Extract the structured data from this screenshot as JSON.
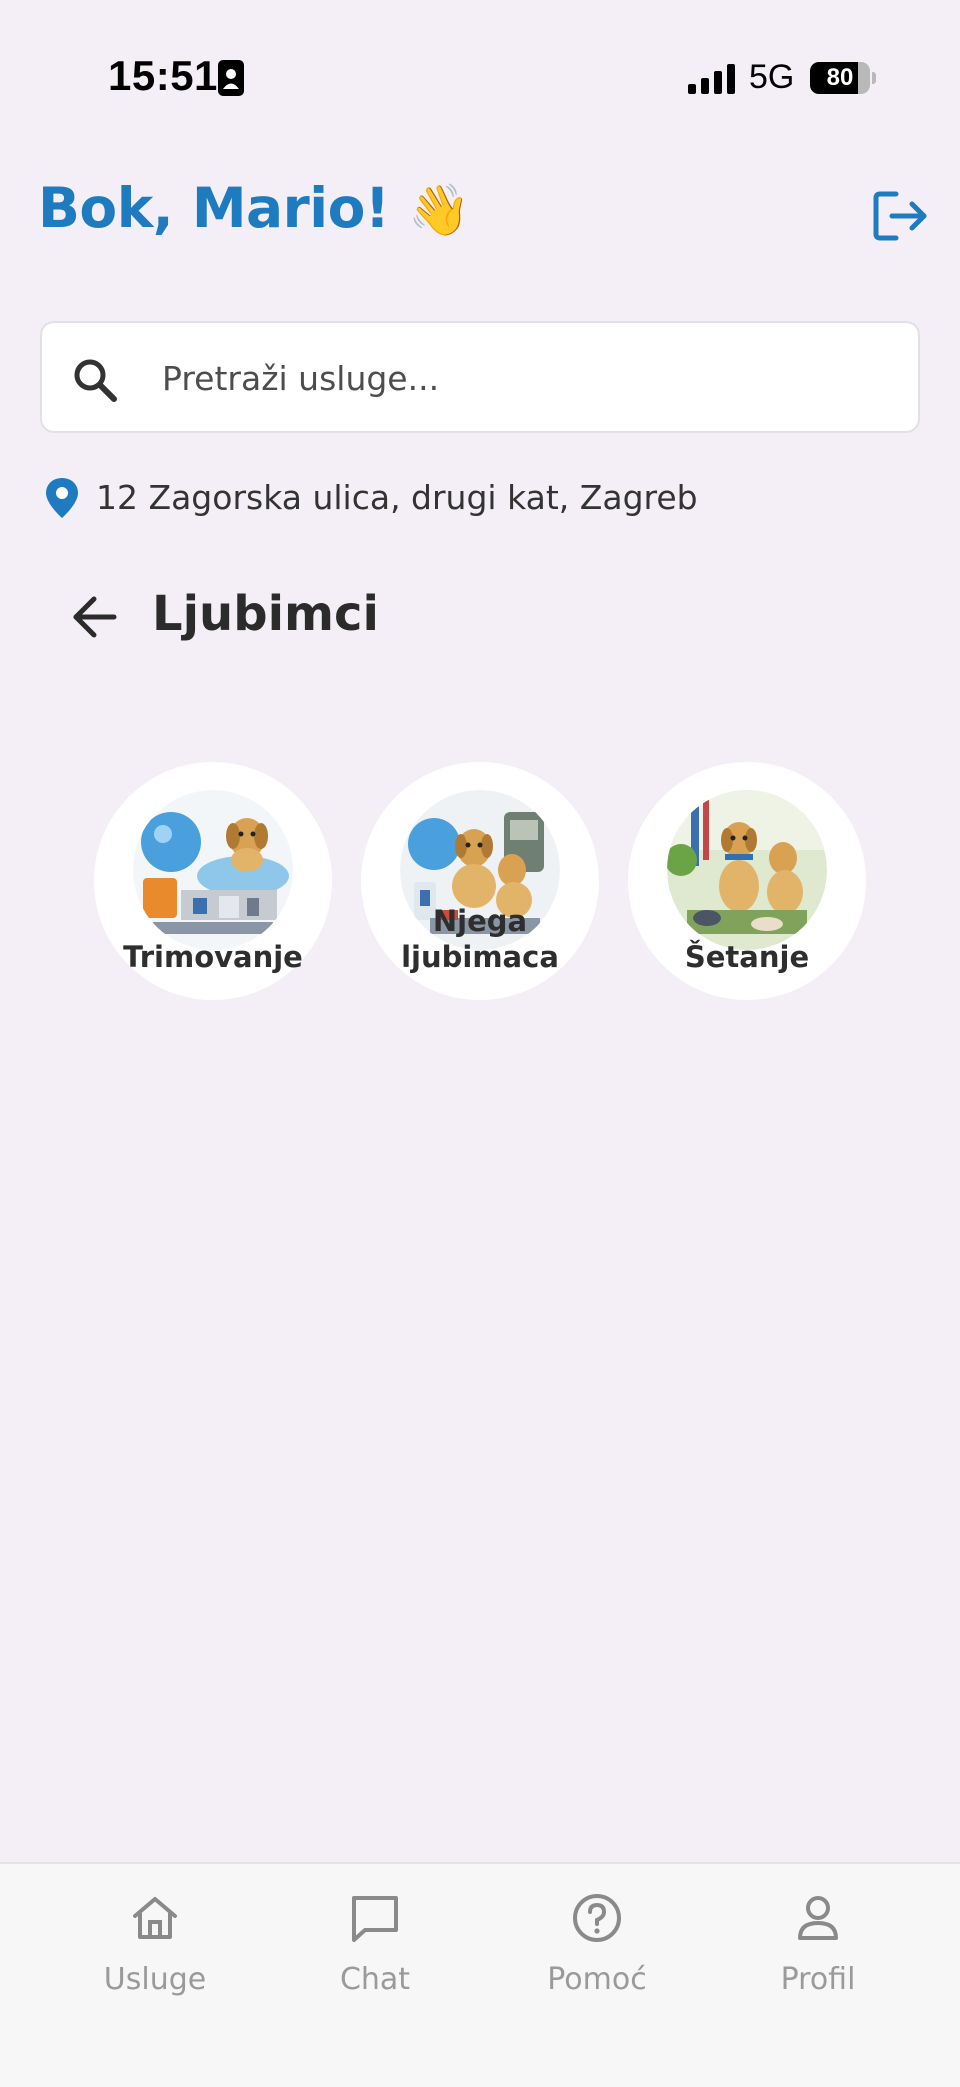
{
  "status_bar": {
    "time": "15:51",
    "network": "5G",
    "battery": "80",
    "battery_fraction": 0.8
  },
  "header": {
    "greeting": "Bok, Mario!",
    "wave_emoji": "👋",
    "logout_icon": "logout-icon"
  },
  "search": {
    "placeholder": "Pretraži usluge..."
  },
  "location": {
    "address": "12 Zagorska ulica, drugi kat, Zagreb"
  },
  "section": {
    "title": "Ljubimci"
  },
  "categories": [
    {
      "label_line1": "Trimovanje",
      "label_line2": ""
    },
    {
      "label_line1": "Njega",
      "label_line2": "ljubimaca"
    },
    {
      "label_line1": "Šetanje",
      "label_line2": ""
    }
  ],
  "bottom_nav": [
    {
      "label": "Usluge",
      "icon": "home-icon"
    },
    {
      "label": "Chat",
      "icon": "chat-icon"
    },
    {
      "label": "Pomoć",
      "icon": "help-icon"
    },
    {
      "label": "Profil",
      "icon": "profile-icon"
    }
  ],
  "colors": {
    "brand": "#1f7bbf",
    "background": "#f4eff6",
    "nav_inactive": "#9a9a9a"
  }
}
